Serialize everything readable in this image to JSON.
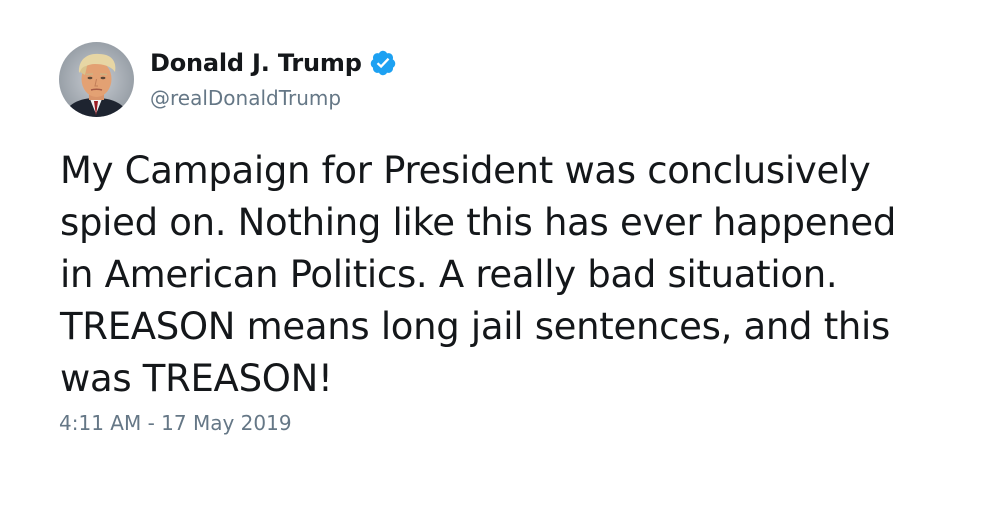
{
  "tweet": {
    "author": {
      "display_name": "Donald J. Trump",
      "handle": "@realDonaldTrump",
      "verified": true,
      "avatar_icon": "profile-photo"
    },
    "text_lines": [
      "My Campaign for President was conclusively",
      "spied on. Nothing like this has ever happened",
      "in American Politics. A really bad situation.",
      "TREASON means long jail sentences, and this",
      "was TREASON!"
    ],
    "timestamp": "4:11 AM - 17 May 2019"
  },
  "colors": {
    "text": "#14171a",
    "secondary_text": "#657786",
    "verified_badge": "#1da1f2",
    "background": "#ffffff"
  }
}
